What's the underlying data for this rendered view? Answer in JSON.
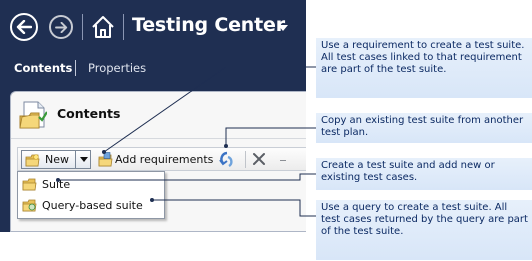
{
  "window": {
    "title": "Testing Center"
  },
  "tabs": [
    {
      "label": "Contents",
      "active": true
    },
    {
      "label": "Properties",
      "active": false
    }
  ],
  "panel": {
    "title": "Contents"
  },
  "toolbar": {
    "new_label": "New",
    "add_requirements_label": "Add requirements"
  },
  "new_menu": {
    "items": [
      {
        "label": "Suite",
        "icon": "suite-icon"
      },
      {
        "label": "Query-based suite",
        "icon": "query-suite-icon"
      }
    ]
  },
  "callouts": [
    {
      "text": "Use a requirement to create a test suite. All test cases linked to that requirement are part of the test suite."
    },
    {
      "text": "Copy an existing test suite from another test plan."
    },
    {
      "text": "Create a test suite and add new or existing test cases."
    },
    {
      "text": "Use a query to create a test suite. All test cases returned by the query are part of the test suite."
    }
  ],
  "colors": {
    "window_background": "#1f2f52",
    "callout_background": "#dfeafa",
    "callout_text": "#0c2a63",
    "leader_line": "#1f2f52"
  },
  "icons": [
    "back-icon",
    "forward-icon",
    "home-icon",
    "dropdown-caret-icon",
    "test-suite-icon",
    "new-suite-icon",
    "requirement-icon",
    "copy-suite-icon",
    "delete-icon",
    "more-icon",
    "suite-icon",
    "query-suite-icon"
  ]
}
